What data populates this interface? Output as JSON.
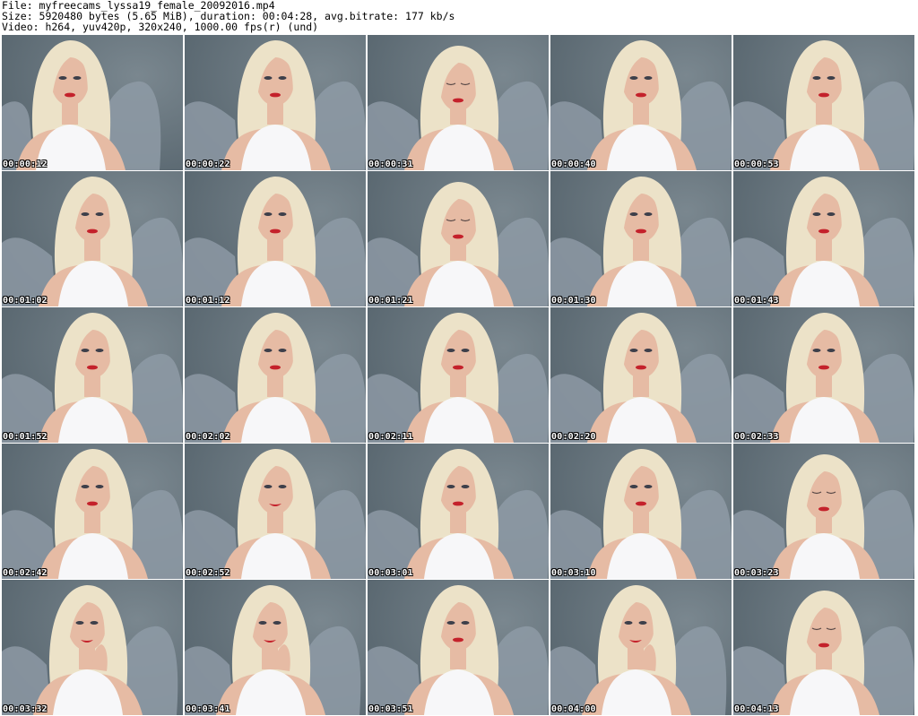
{
  "header": {
    "file_line": "File: myfreecams_lyssa19_female_20092016.mp4",
    "size_line": "Size: 5920480 bytes (5.65 MiB), duration: 00:04:28, avg.bitrate: 177 kb/s",
    "video_line": "Video: h264, yuv420p, 320x240, 1000.00 fps(r) (und)"
  },
  "thumbnails": [
    {
      "timestamp": "00:00:12",
      "pose": "tilt"
    },
    {
      "timestamp": "00:00:22",
      "pose": "center"
    },
    {
      "timestamp": "00:00:31",
      "pose": "down"
    },
    {
      "timestamp": "00:00:40",
      "pose": "center"
    },
    {
      "timestamp": "00:00:53",
      "pose": "center"
    },
    {
      "timestamp": "00:01:02",
      "pose": "center"
    },
    {
      "timestamp": "00:01:12",
      "pose": "center"
    },
    {
      "timestamp": "00:01:21",
      "pose": "down"
    },
    {
      "timestamp": "00:01:30",
      "pose": "center"
    },
    {
      "timestamp": "00:01:43",
      "pose": "center"
    },
    {
      "timestamp": "00:01:52",
      "pose": "center"
    },
    {
      "timestamp": "00:02:02",
      "pose": "center"
    },
    {
      "timestamp": "00:02:11",
      "pose": "center"
    },
    {
      "timestamp": "00:02:20",
      "pose": "center"
    },
    {
      "timestamp": "00:02:33",
      "pose": "center"
    },
    {
      "timestamp": "00:02:42",
      "pose": "center"
    },
    {
      "timestamp": "00:02:52",
      "pose": "smile"
    },
    {
      "timestamp": "00:03:01",
      "pose": "center"
    },
    {
      "timestamp": "00:03:10",
      "pose": "center"
    },
    {
      "timestamp": "00:03:23",
      "pose": "down"
    },
    {
      "timestamp": "00:03:32",
      "pose": "hand"
    },
    {
      "timestamp": "00:03:41",
      "pose": "hand"
    },
    {
      "timestamp": "00:03:51",
      "pose": "center"
    },
    {
      "timestamp": "00:04:00",
      "pose": "hand"
    },
    {
      "timestamp": "00:04:13",
      "pose": "down"
    }
  ],
  "colors": {
    "wall": "#56646d",
    "blanket": "#8d99a4",
    "hair": "#ece2c8",
    "skin": "#e6bba4",
    "top": "#f7f7f9",
    "lips": "#c4212b"
  }
}
